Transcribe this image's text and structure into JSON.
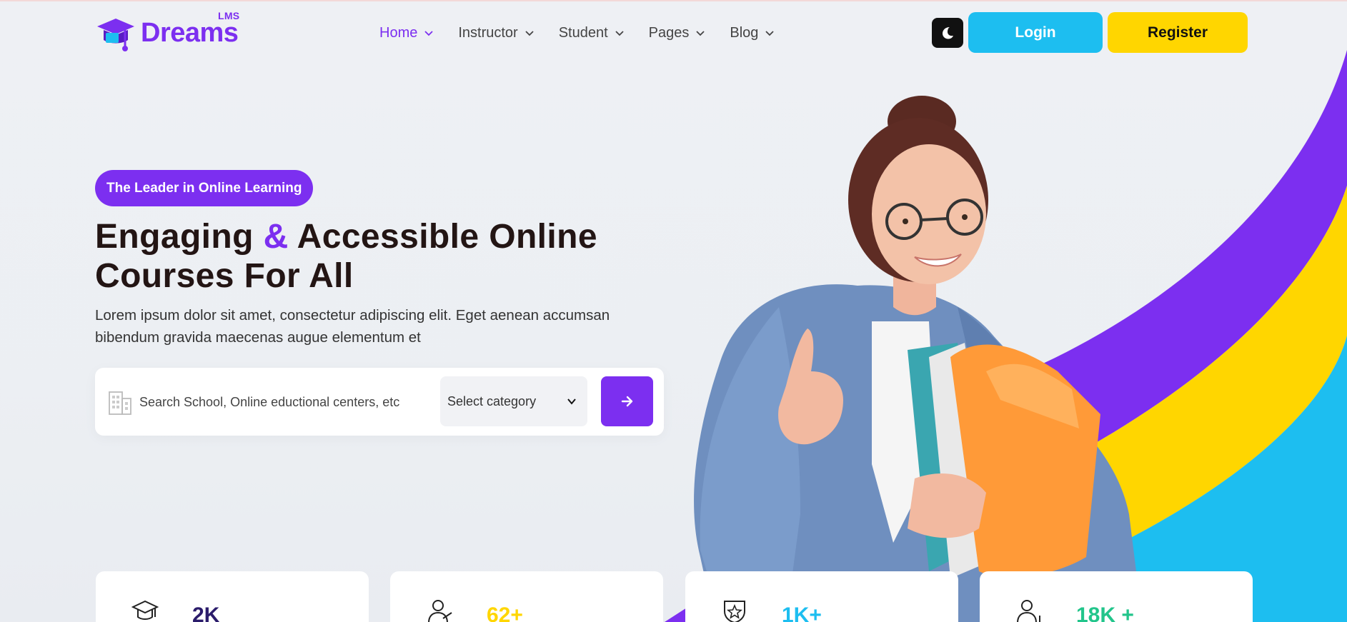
{
  "brand": {
    "name": "Dreams",
    "sub": "LMS",
    "color": "#7c2ff0"
  },
  "nav": {
    "items": [
      {
        "label": "Home",
        "active": true
      },
      {
        "label": "Instructor",
        "active": false
      },
      {
        "label": "Student",
        "active": false
      },
      {
        "label": "Pages",
        "active": false
      },
      {
        "label": "Blog",
        "active": false
      }
    ]
  },
  "header": {
    "theme_icon": "moon-icon",
    "login_label": "Login",
    "register_label": "Register"
  },
  "hero": {
    "badge": "The Leader in Online Learning",
    "title_part1": "Engaging",
    "title_amp": "&",
    "title_part2": "Accessible Online",
    "title_line2": "Courses For All",
    "description": "Lorem ipsum dolor sit amet, consectetur adipiscing elit. Eget aenean accumsan bibendum gravida maecenas augue elementum et"
  },
  "search": {
    "placeholder": "Search School, Online eductional centers, etc",
    "category_label": "Select category",
    "submit_icon": "arrow-right-icon"
  },
  "stats": [
    {
      "icon": "graduation-cap-icon",
      "value": "2K",
      "color": "#2b1c6b"
    },
    {
      "icon": "teacher-icon",
      "value": "62+",
      "color": "#ffd600"
    },
    {
      "icon": "award-badge-icon",
      "value": "1K+",
      "color": "#1dbef0"
    },
    {
      "icon": "student-icon",
      "value": "18K +",
      "color": "#22c58b"
    }
  ],
  "colors": {
    "purple": "#7c2ff0",
    "blue": "#1dbef0",
    "yellow": "#ffd600",
    "dark": "#231514"
  }
}
